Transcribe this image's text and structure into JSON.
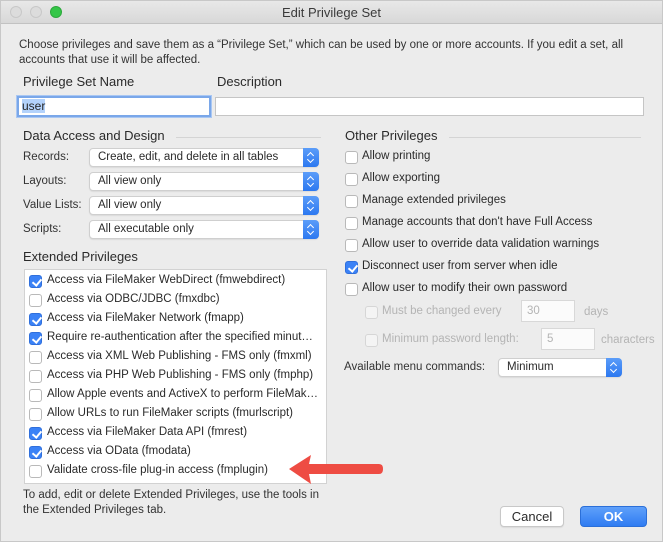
{
  "window": {
    "title": "Edit Privilege Set"
  },
  "intro_text": "Choose privileges and save them as a “Privilege Set,” which can be used by one or more accounts. If you edit a set, all accounts that use it will be affected.",
  "name_field": {
    "label": "Privilege Set Name",
    "value": "user"
  },
  "description_field": {
    "label": "Description",
    "value": ""
  },
  "data_access": {
    "heading": "Data Access and Design",
    "rows": [
      {
        "label": "Records:",
        "value": "Create, edit, and delete in all tables"
      },
      {
        "label": "Layouts:",
        "value": "All view only"
      },
      {
        "label": "Value Lists:",
        "value": "All view only"
      },
      {
        "label": "Scripts:",
        "value": "All executable only"
      }
    ]
  },
  "extended": {
    "heading": "Extended Privileges",
    "items": [
      {
        "label": "Access via FileMaker WebDirect (fmwebdirect)",
        "checked": true
      },
      {
        "label": "Access via ODBC/JDBC (fmxdbc)",
        "checked": false
      },
      {
        "label": "Access via FileMaker Network (fmapp)",
        "checked": true
      },
      {
        "label": "Require re-authentication after the specified minut…",
        "checked": true
      },
      {
        "label": "Access via XML Web Publishing - FMS only (fmxml)",
        "checked": false
      },
      {
        "label": "Access via PHP Web Publishing - FMS only (fmphp)",
        "checked": false
      },
      {
        "label": "Allow Apple events and ActiveX to perform FileMak…",
        "checked": false
      },
      {
        "label": "Allow URLs to run FileMaker scripts (fmurlscript)",
        "checked": false
      },
      {
        "label": "Access via FileMaker Data API (fmrest)",
        "checked": true
      },
      {
        "label": "Access via OData (fmodata)",
        "checked": true
      },
      {
        "label": "Validate cross-file plug-in access (fmplugin)",
        "checked": false
      }
    ],
    "note": "To add, edit or delete Extended Privileges, use the tools in the Extended Privileges tab."
  },
  "other": {
    "heading": "Other Privileges",
    "items": [
      {
        "label": "Allow printing",
        "checked": false
      },
      {
        "label": "Allow exporting",
        "checked": false
      },
      {
        "label": "Manage extended privileges",
        "checked": false
      },
      {
        "label": "Manage accounts that don't have Full Access",
        "checked": false
      },
      {
        "label": "Allow user to override data validation warnings",
        "checked": false
      },
      {
        "label": "Disconnect user from server when idle",
        "checked": true
      },
      {
        "label": "Allow user to modify their own password",
        "checked": false
      }
    ],
    "password_change": {
      "label": "Must be changed every",
      "value": "30",
      "unit": "days",
      "checked": false,
      "disabled": true
    },
    "password_length": {
      "label": "Minimum password length:",
      "value": "5",
      "unit": "characters",
      "checked": false,
      "disabled": true
    },
    "menu_commands": {
      "label": "Available menu commands:",
      "value": "Minimum"
    }
  },
  "buttons": {
    "cancel": "Cancel",
    "ok": "OK"
  },
  "annotation": {
    "arrow_color": "#ee4c43"
  }
}
